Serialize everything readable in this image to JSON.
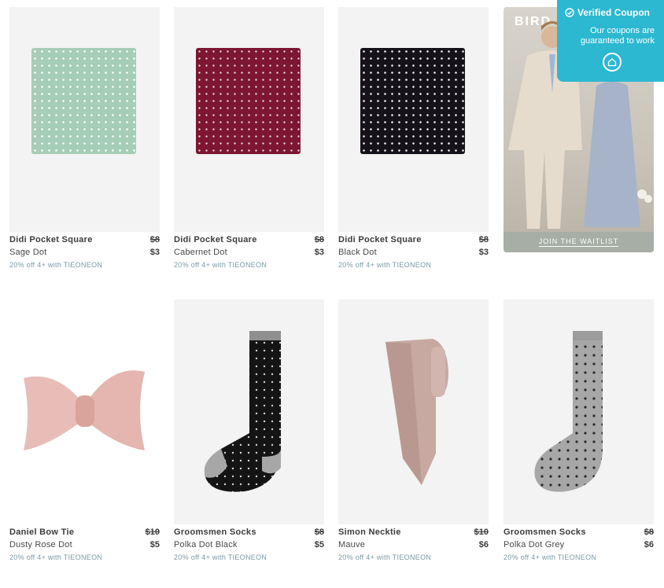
{
  "products": [
    {
      "name": "Didi Pocket Square",
      "variant": "Sage Dot",
      "old_price": "$8",
      "price": "$3",
      "promo": "20% off 4+ with TIEONEON"
    },
    {
      "name": "Didi Pocket Square",
      "variant": "Cabernet Dot",
      "old_price": "$8",
      "price": "$3",
      "promo": "20% off 4+ with TIEONEON"
    },
    {
      "name": "Didi Pocket Square",
      "variant": "Black Dot",
      "old_price": "$8",
      "price": "$3",
      "promo": "20% off 4+ with TIEONEON"
    },
    {
      "name": "Daniel Bow Tie",
      "variant": "Dusty Rose Dot",
      "old_price": "$10",
      "price": "$5",
      "promo": "20% off 4+ with TIEONEON"
    },
    {
      "name": "Groomsmen Socks",
      "variant": "Polka Dot Black",
      "old_price": "$8",
      "price": "$5",
      "promo": "20% off 4+ with TIEONEON"
    },
    {
      "name": "Simon Necktie",
      "variant": "Mauve",
      "old_price": "$10",
      "price": "$6",
      "promo": "20% off 4+ with TIEONEON"
    },
    {
      "name": "Groomsmen Socks",
      "variant": "Polka Dot Grey",
      "old_price": "$8",
      "price": "$6",
      "promo": "20% off 4+ with TIEONEON"
    }
  ],
  "ad": {
    "brand": "BIRD",
    "cta": "JOIN THE WAITLIST"
  },
  "coupon": {
    "title": "Verified Coupon",
    "subtitle_line1": "Our coupons are",
    "subtitle_line2": "guaranteed to work",
    "icon": "coupon-logo-icon"
  },
  "colors": {
    "promo": "#7a9aa6",
    "coupon_bg": "#2cb8d1"
  }
}
